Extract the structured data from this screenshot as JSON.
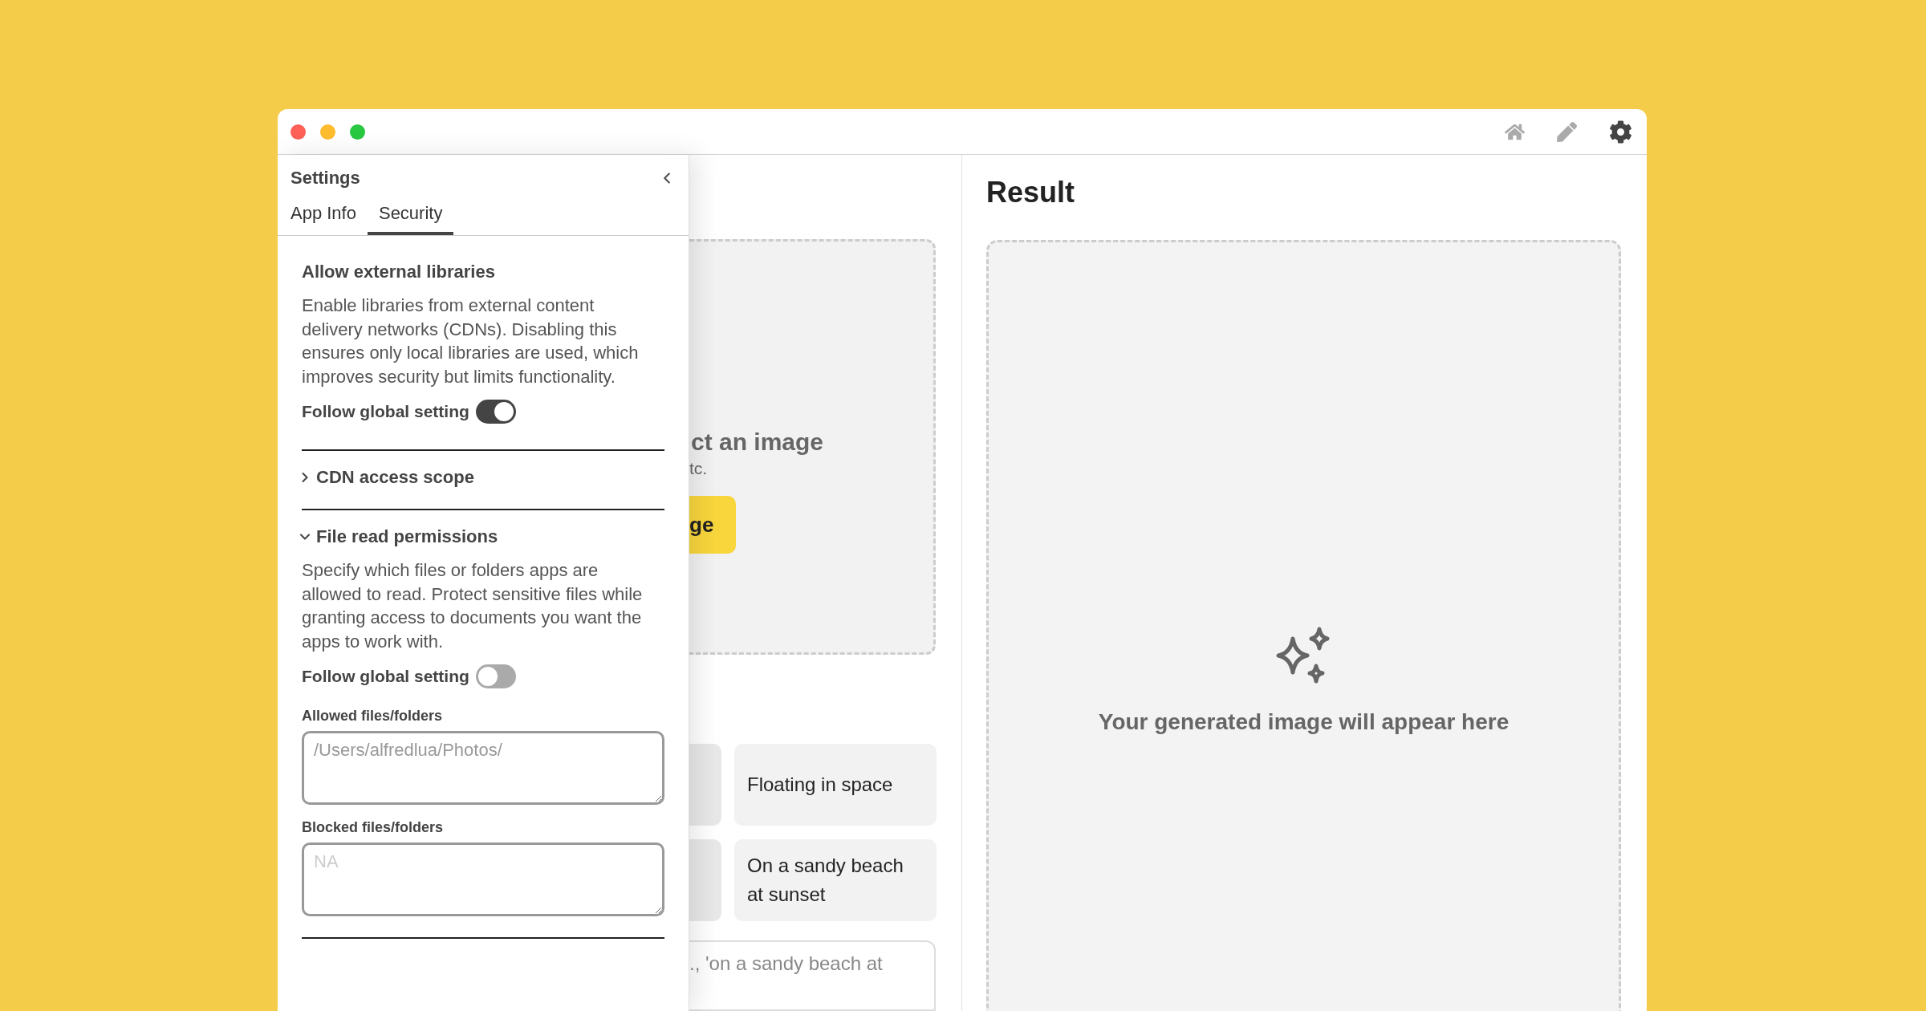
{
  "toolbar": [
    {
      "kind": "home",
      "selected": false
    },
    {
      "kind": "edit",
      "selected": false
    },
    {
      "kind": "settings",
      "selected": true
    }
  ],
  "settings": {
    "title": "Settings",
    "tabs": [
      {
        "label": "App Info",
        "selected": false
      },
      {
        "label": "Security",
        "selected": true
      }
    ],
    "sections": [
      {
        "kind": "toggle",
        "title": "Allow external libraries",
        "description": "Enable libraries from external content delivery networks (CDNs). Disabling this ensures only local libraries are used, which improves security but limits functionality.",
        "toggle": {
          "label": "Follow global setting",
          "on": true
        }
      },
      {
        "kind": "collapsible",
        "title": "CDN access scope",
        "expanded": false
      },
      {
        "kind": "collapsible",
        "title": "File read permissions",
        "expanded": true,
        "description": "Specify which files or folders apps are allowed to read. Protect sensitive files while granting access to documents you want the apps to work with.",
        "toggle": {
          "label": "Follow global setting",
          "on": false
        },
        "fields": [
          {
            "label": "Allowed files/folders",
            "value": "/Users/alfredlua/Photos/"
          },
          {
            "label": "Blocked files/folders",
            "placeholder": "NA"
          }
        ]
      }
    ]
  },
  "upload": {
    "title": "ct an image",
    "hint": "tc.",
    "button": "ge"
  },
  "suggestions": [
    [
      {
        "kind": "covered"
      },
      {
        "kind": "text",
        "label": "Floating in space"
      }
    ],
    [
      {
        "kind": "covered"
      },
      {
        "kind": "text",
        "label": "On a sandy beach at sunset"
      }
    ]
  ],
  "prompt": {
    "placeholder": "., 'on a sandy beach at"
  },
  "result": {
    "title": "Result",
    "placeholder": "Your generated image will appear here"
  }
}
